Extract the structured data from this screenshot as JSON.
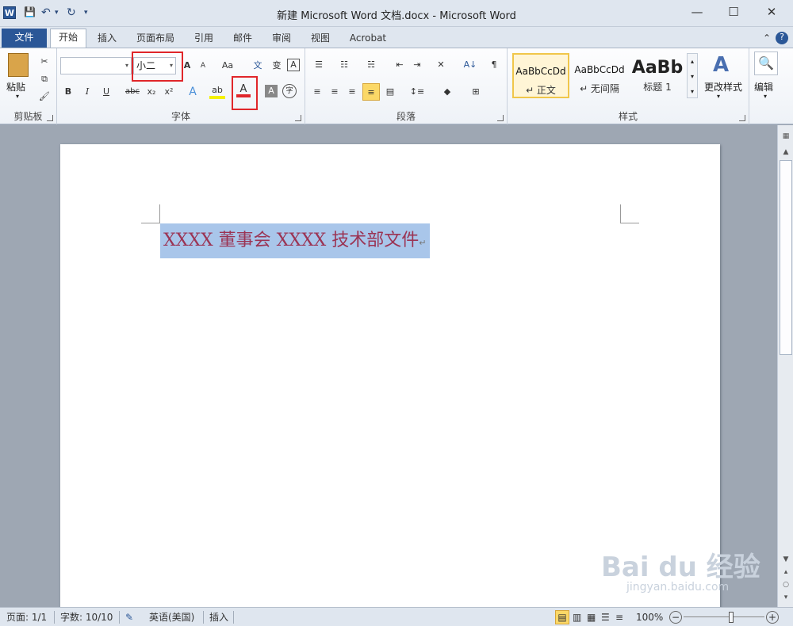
{
  "window": {
    "title": "新建 Microsoft Word 文档.docx - Microsoft Word",
    "app_icon": "W"
  },
  "qat": {
    "save": "💾",
    "undo": "↶",
    "undo_dd": "▾",
    "redo": "↻",
    "customize": "▾"
  },
  "controls": {
    "minimize": "—",
    "maximize": "☐",
    "close": "✕"
  },
  "tabs": {
    "file": "文件",
    "items": [
      "开始",
      "插入",
      "页面布局",
      "引用",
      "邮件",
      "审阅",
      "视图",
      "Acrobat"
    ]
  },
  "ribbon_right": {
    "collapse": "⌃",
    "help": "?"
  },
  "clipboard": {
    "paste": "粘贴",
    "label": "剪贴板",
    "paste_dd": "▾"
  },
  "font": {
    "label": "字体",
    "name_value": "",
    "size_value": "小二",
    "grow": "A",
    "shrink": "A",
    "change_case": "Aa",
    "bold": "B",
    "italic": "I",
    "underline": "U",
    "strike": "abc",
    "sub": "x₂",
    "sup": "x²",
    "effects": "A",
    "highlight": "ab",
    "font_color": "A",
    "char_shade": "A",
    "enclose": "字"
  },
  "paragraph": {
    "label": "段落",
    "sort": "A↓",
    "marks": "¶"
  },
  "styles": {
    "label": "样式",
    "items": [
      {
        "sample": "AaBbCcDd",
        "name": "↵ 正文"
      },
      {
        "sample": "AaBbCcDd",
        "name": "↵ 无间隔"
      },
      {
        "sample": "AaBb",
        "name": "标题 1"
      }
    ],
    "change": "更改样式",
    "change_icon": "A"
  },
  "editing": {
    "label": "编辑",
    "icon": "🔍"
  },
  "document": {
    "text": "XXXX 董事会 XXXX 技术部文件",
    "para_mark": "↵"
  },
  "status": {
    "page": "页面: 1/1",
    "words": "字数: 10/10",
    "language": "英语(美国)",
    "mode": "插入",
    "zoom": "100%",
    "zoom_minus": "−",
    "zoom_plus": "+",
    "zoom_level": 100
  },
  "watermark": {
    "brand": "Bai du 经验",
    "url": "jingyan.baidu.com"
  },
  "colors": {
    "accent": "#2b5797",
    "highlight_box": "#e0262a",
    "text_color": "#9b3454",
    "selection": "#a9c6ea"
  }
}
